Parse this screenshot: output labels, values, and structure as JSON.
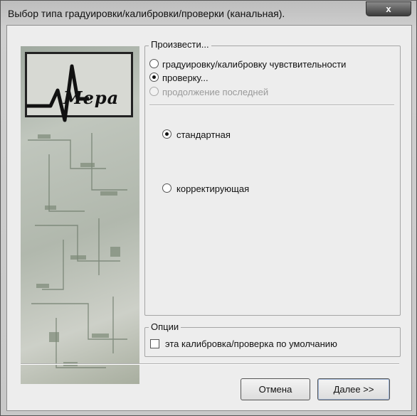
{
  "window": {
    "title": "Выбор типа градуировки/калибровки/проверки (канальная).",
    "close_label": "x"
  },
  "logo": {
    "text": "Мера"
  },
  "action_group": {
    "legend": "Произвести...",
    "options": [
      {
        "label": "градуировку/калибровку чувствительности",
        "checked": false,
        "disabled": false
      },
      {
        "label": "проверку...",
        "checked": true,
        "disabled": false
      },
      {
        "label": "продолжение последней",
        "checked": false,
        "disabled": true
      }
    ]
  },
  "check_type": {
    "options": [
      {
        "label": "стандартная",
        "checked": true
      },
      {
        "label": "корректирующая",
        "checked": false
      }
    ]
  },
  "options_group": {
    "legend": "Опции",
    "default_checkbox_label": "эта калибровка/проверка по умолчанию",
    "default_checked": false
  },
  "buttons": {
    "cancel": "Отмена",
    "next": "Далее >>"
  },
  "colors": {
    "client_bg": "#ededed",
    "frame": "#c9c9c9",
    "close_button": "#3c3c3c"
  }
}
